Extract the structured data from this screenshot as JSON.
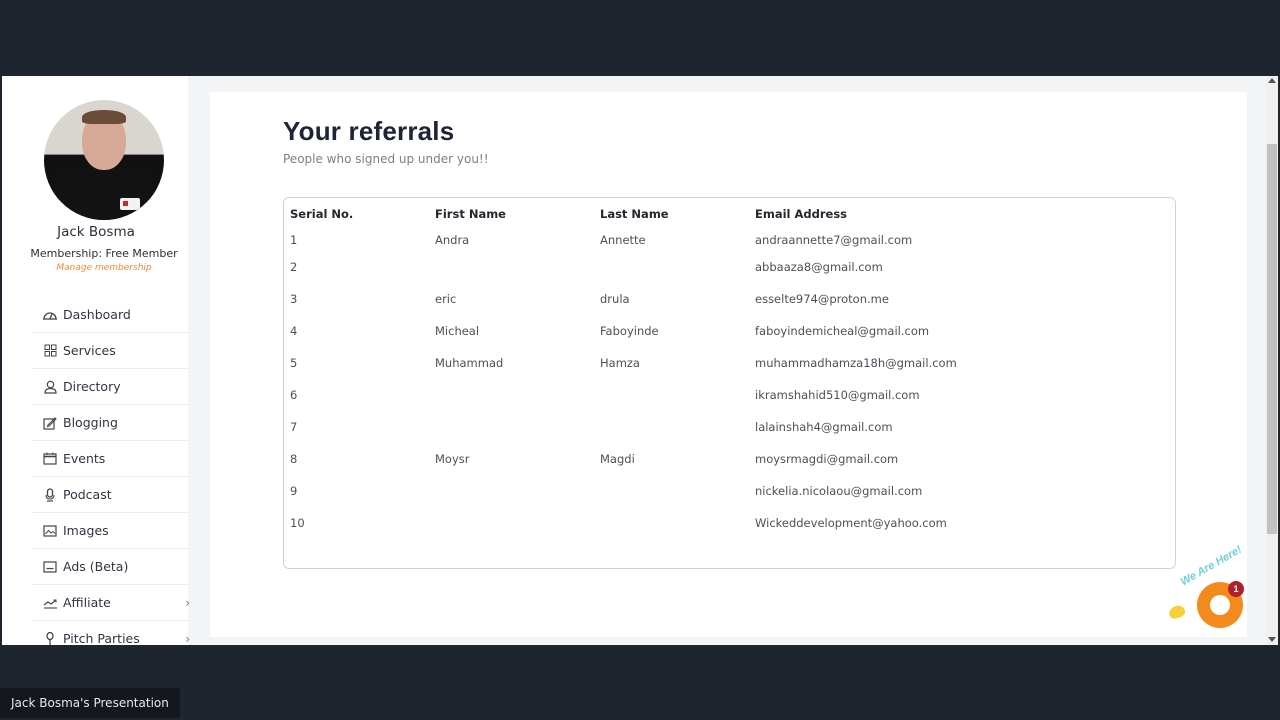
{
  "profile": {
    "name": "Jack Bosma",
    "membership_label": "Membership:",
    "membership_value": "Free Member",
    "membership_text": "Membership:  Free Member",
    "manage_link": "Manage membership"
  },
  "sidebar": {
    "items": [
      {
        "label": "Dashboard",
        "icon": "dashboard-icon",
        "has_chevron": false
      },
      {
        "label": "Services",
        "icon": "grid-icon",
        "has_chevron": false
      },
      {
        "label": "Directory",
        "icon": "user-icon",
        "has_chevron": false
      },
      {
        "label": "Blogging",
        "icon": "edit-icon",
        "has_chevron": false
      },
      {
        "label": "Events",
        "icon": "calendar-icon",
        "has_chevron": false
      },
      {
        "label": "Podcast",
        "icon": "microphone-icon",
        "has_chevron": false
      },
      {
        "label": "Images",
        "icon": "image-icon",
        "has_chevron": false
      },
      {
        "label": "Ads (Beta)",
        "icon": "ad-icon",
        "has_chevron": false
      },
      {
        "label": "Affiliate",
        "icon": "trending-icon",
        "has_chevron": true
      },
      {
        "label": "Pitch Parties",
        "icon": "mic-stand-icon",
        "has_chevron": true
      }
    ],
    "chevron": "›"
  },
  "main": {
    "title": "Your referrals",
    "subtitle": "People who signed up under you!!",
    "table": {
      "headers": [
        "Serial No.",
        "First Name",
        "Last Name",
        "Email Address"
      ],
      "rows": [
        [
          "1",
          "Andra",
          "Annette",
          "andraannette7@gmail.com"
        ],
        [
          "2",
          "",
          "",
          "abbaaza8@gmail.com"
        ],
        [
          "3",
          "eric",
          "drula",
          "esselte974@proton.me"
        ],
        [
          "4",
          "Micheal",
          "Faboyinde",
          "faboyindemicheal@gmail.com"
        ],
        [
          "5",
          "Muhammad",
          "Hamza",
          "muhammadhamza18h@gmail.com"
        ],
        [
          "6",
          "",
          "",
          "ikramshahid510@gmail.com"
        ],
        [
          "7",
          "",
          "",
          "lalainshah4@gmail.com"
        ],
        [
          "8",
          "Moysr",
          "Magdi",
          "moysrmagdi@gmail.com"
        ],
        [
          "9",
          "",
          "",
          "nickelia.nicolaou@gmail.com"
        ],
        [
          "10",
          "",
          "",
          "Wickeddevelopment@yahoo.com"
        ]
      ]
    }
  },
  "chat_widget": {
    "tagline": "We Are Here!",
    "badge_count": "1",
    "accent_color": "#f28b1c"
  },
  "presenter_label": "Jack Bosma's Presentation",
  "colors": {
    "accent_orange": "#ee8a3a",
    "frame_dark": "#1f252e",
    "title": "#1e2435"
  }
}
